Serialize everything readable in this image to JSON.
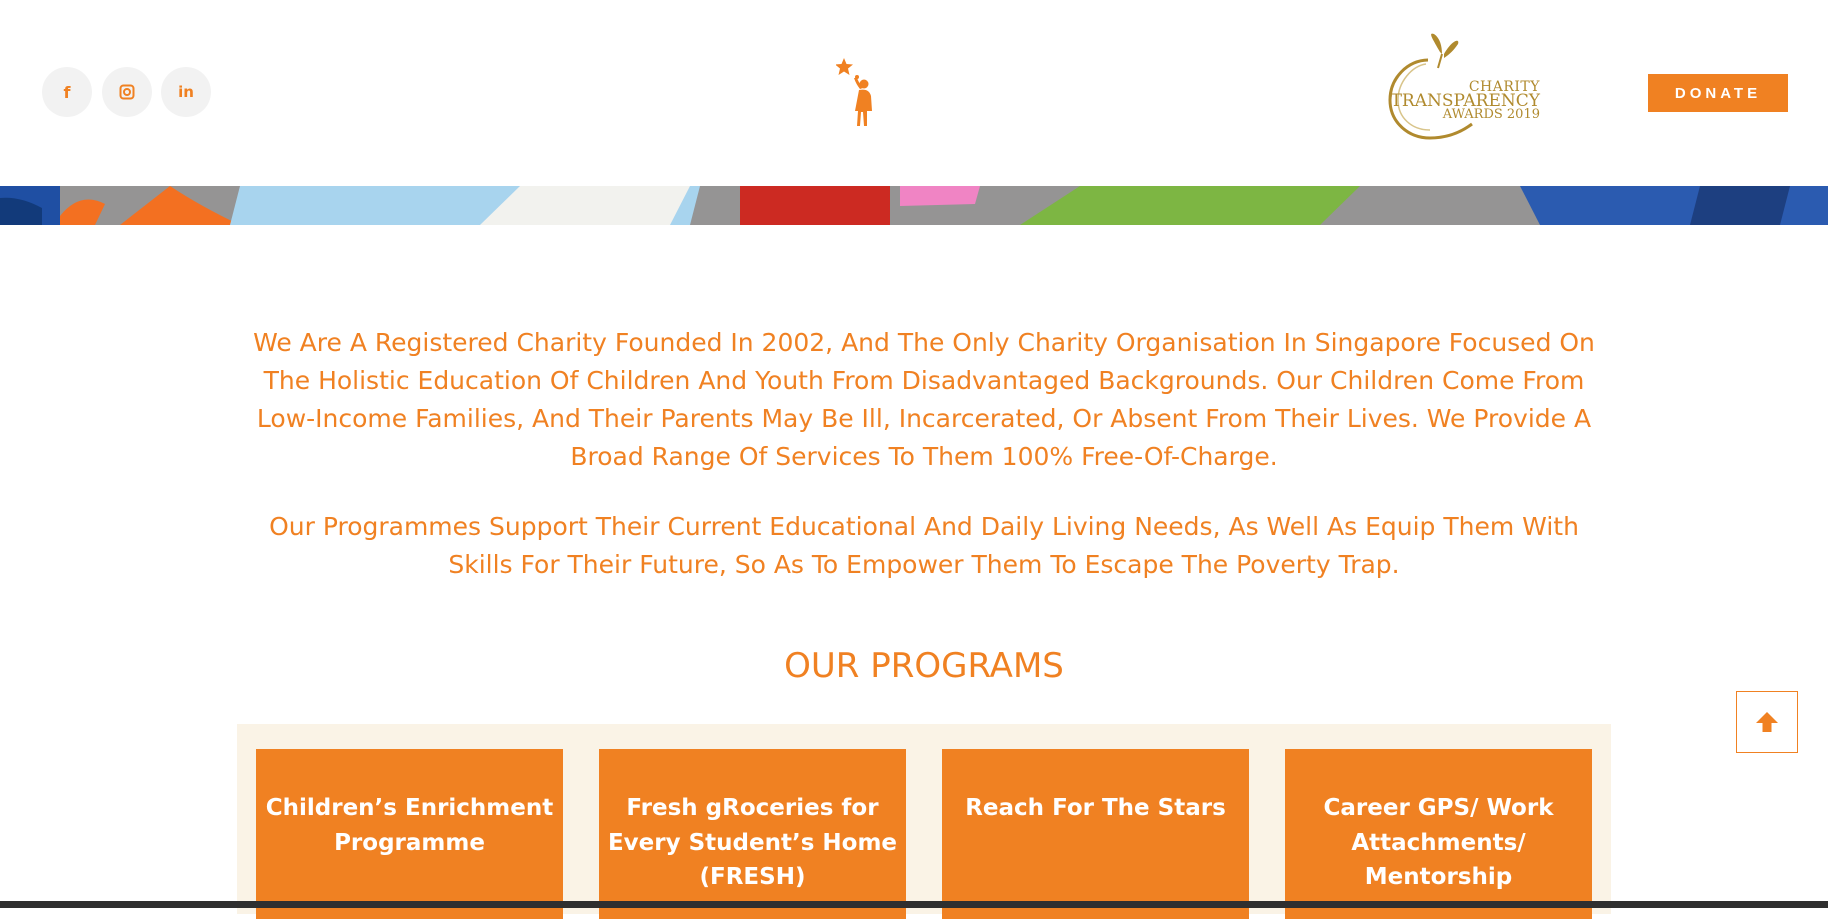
{
  "header": {
    "social": [
      {
        "icon": "facebook-icon",
        "glyph": "f"
      },
      {
        "icon": "instagram-icon",
        "glyph": "◘"
      },
      {
        "icon": "linkedin-icon",
        "glyph": "in"
      }
    ],
    "award": {
      "line1": "CHARITY",
      "line2": "TRANSPARENCY",
      "line3": "AWARDS 2019"
    },
    "donate_label": "DONATE"
  },
  "intro": {
    "paragraph1": "We Are A Registered Charity Founded In 2002, And The Only Charity Organisation In Singapore Focused On The Holistic Education Of Children And Youth From Disadvantaged Backgrounds. Our Children Come From Low-Income Families, And Their Parents May Be Ill, Incarcerated, Or Absent From Their Lives. We Provide A Broad Range Of Services To Them 100% Free-Of-Charge.",
    "paragraph2": "Our Programmes Support Their Current Educational And Daily Living Needs, As Well As Equip Them With Skills For Their Future, So As To Empower Them To Escape The Poverty Trap."
  },
  "programs": {
    "title": "OUR PROGRAMS",
    "cards": [
      {
        "label": "Children’s Enrichment Programme"
      },
      {
        "label": "Fresh gRoceries for Every Student’s Home (FRESH)"
      },
      {
        "label": "Reach For The Stars"
      },
      {
        "label": "Career GPS/ Work Attachments/ Mentorship"
      }
    ]
  },
  "colors": {
    "accent": "#f08122",
    "award_gold": "#b08a2e",
    "program_bg": "#faf3e6"
  }
}
